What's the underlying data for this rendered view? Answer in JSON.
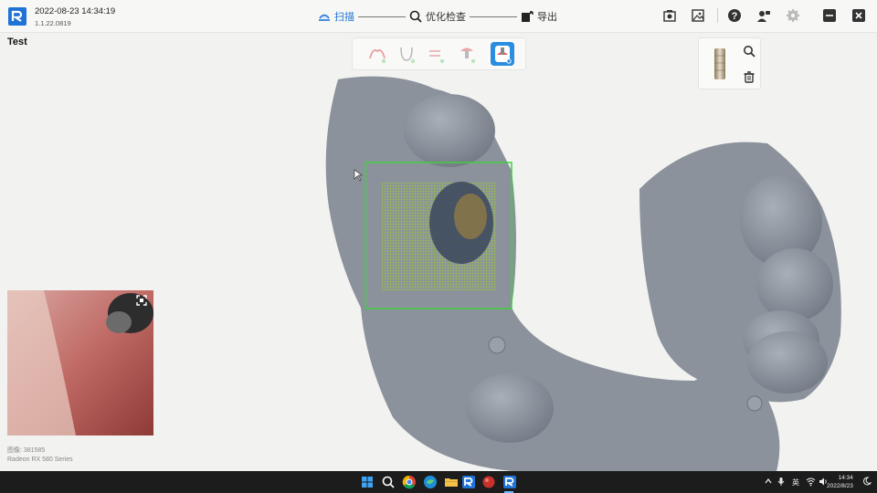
{
  "app": {
    "datetime": "2022-08-23 14:34:19",
    "version": "1.1.22.0819",
    "project_title": "Test"
  },
  "workflow_steps": [
    {
      "label": "扫描",
      "icon": "scan-icon",
      "active": true
    },
    {
      "label": "优化检查",
      "icon": "optimize-check-icon",
      "active": false
    },
    {
      "label": "导出",
      "icon": "export-icon",
      "active": false
    }
  ],
  "toolbar_right": [
    {
      "icon": "screenshot-icon"
    },
    {
      "icon": "image-gallery-icon"
    },
    {
      "icon": "help-icon"
    },
    {
      "icon": "remote-support-icon"
    },
    {
      "icon": "settings-gear-icon"
    },
    {
      "icon": "minimize-icon"
    },
    {
      "icon": "close-icon"
    }
  ],
  "scan_tools": [
    {
      "icon": "upper-jaw-icon"
    },
    {
      "icon": "lower-jaw-icon"
    },
    {
      "icon": "bite-icon"
    },
    {
      "icon": "implant-icon"
    },
    {
      "icon": "scanbody-icon",
      "active": true
    }
  ],
  "scanbody_panel": {
    "icons": [
      "scanbody-cylinder-icon",
      "zoom-search-icon",
      "trash-icon"
    ]
  },
  "camera_preview": {
    "expand_icon": "expand-icon"
  },
  "status": {
    "image_count_label": "图像: 381585",
    "gpu": "Radeon RX 580 Series"
  },
  "taskbar": {
    "apps": [
      "start-icon",
      "search-icon",
      "chrome-icon",
      "edge-icon",
      "file-explorer-icon",
      "scanner-app-icon",
      "red-app-icon",
      "scanner-app-active-icon"
    ],
    "tray_input_method": "英",
    "time": "14:34",
    "date": "2022/8/23"
  },
  "colors": {
    "accent": "#1f73d6",
    "active_tool": "#2a8de0",
    "scan_box": "#3fcf3f",
    "model": "#8b929c",
    "taskbar": "#1c1c1c"
  }
}
